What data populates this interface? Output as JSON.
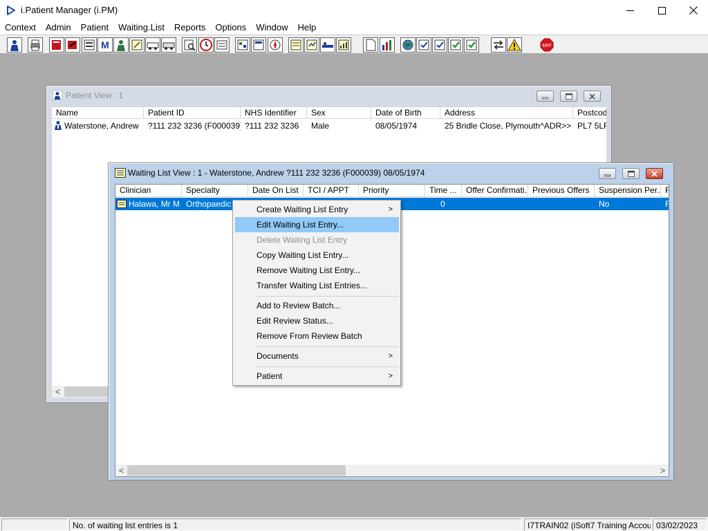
{
  "app": {
    "title": "i.Patient Manager (i.PM)"
  },
  "window_controls": {
    "minimize": "—",
    "maximize": "☐",
    "close": "✕"
  },
  "menu": [
    "Context",
    "Admin",
    "Patient",
    "Waiting.List",
    "Reports",
    "Options",
    "Window",
    "Help"
  ],
  "toolbar": {
    "buttons": [
      "patient-icon",
      "printer-icon",
      "book-icon",
      "referral-icon",
      "register-icon",
      "m-letter-icon",
      "clinician-icon",
      "note-icon",
      "ambulance-icon",
      "transport-icon",
      "search-icon",
      "clock-icon",
      "list-icon",
      "schedule-icon",
      "document-icon",
      "compass-icon",
      "notepad-icon",
      "report-icon",
      "bed-icon",
      "chart-icon",
      "file-icon",
      "bar-chart-icon",
      "globe-icon",
      "check-doc-icon",
      "check-doc-icon",
      "green-check-icon",
      "green-check-icon",
      "swap-icon",
      "warning-icon"
    ],
    "exit_label": "EXIT"
  },
  "patient_view": {
    "title": "Patient View : 1",
    "columns": [
      "Name",
      "Patient ID",
      "NHS Identifier",
      "Sex",
      "Date of Birth",
      "Address",
      "Postcod"
    ],
    "rows": [
      [
        "Waterstone, Andrew",
        "?111 232 3236 (F000039)",
        "?111 232 3236",
        "Male",
        "08/05/1974",
        "25 Bridle Close, Plymouth^ADR>>",
        "PL7 5LF"
      ]
    ]
  },
  "waiting_list_view": {
    "title": "Waiting List View :  1 - Waterstone, Andrew ?111 232 3236 (F000039) 08/05/1974",
    "columns": [
      "Clinician",
      "Specialty",
      "Date On List",
      "TCI / APPT",
      "Priority",
      "Time ...",
      "Offer Confirmati...",
      "Previous Offers",
      "Suspension Per...",
      "F"
    ],
    "rows": [
      {
        "clinician": "Halawa, Mr M",
        "specialty": "Orthopaedic",
        "date_on_list": "",
        "tci_appt": "",
        "priority": "",
        "time": "0",
        "offer_confirmation": "",
        "previous_offers": "",
        "suspension": "No",
        "f": "F",
        "selected": true
      }
    ]
  },
  "context_menu": {
    "items": [
      {
        "label": "Create Waiting List Entry",
        "submenu": true
      },
      {
        "label": "Edit Waiting List Entry...",
        "highlighted": true
      },
      {
        "label": "Delete Waiting List Entry",
        "disabled": true
      },
      {
        "label": "Copy Waiting List Entry..."
      },
      {
        "label": "Remove Waiting List Entry..."
      },
      {
        "label": "Transfer Waiting List Entries..."
      },
      {
        "label": "Add to Review Batch..."
      },
      {
        "label": "Edit Review Status..."
      },
      {
        "label": "Remove From Review Batch"
      },
      {
        "label": "Documents",
        "submenu": true
      },
      {
        "label": "Patient",
        "submenu": true
      }
    ]
  },
  "status_bar": {
    "message": "No. of waiting list entries is 1",
    "account": "I7TRAIN02 (iSoft7 Training Account)",
    "date": "03/02/2023"
  },
  "colors": {
    "selection": "#0078d7",
    "menu_highlight": "#91c9f7",
    "inactive_caption": "#d4dbe4",
    "active_caption": "#bcd2ea",
    "workspace": "#ababab"
  }
}
